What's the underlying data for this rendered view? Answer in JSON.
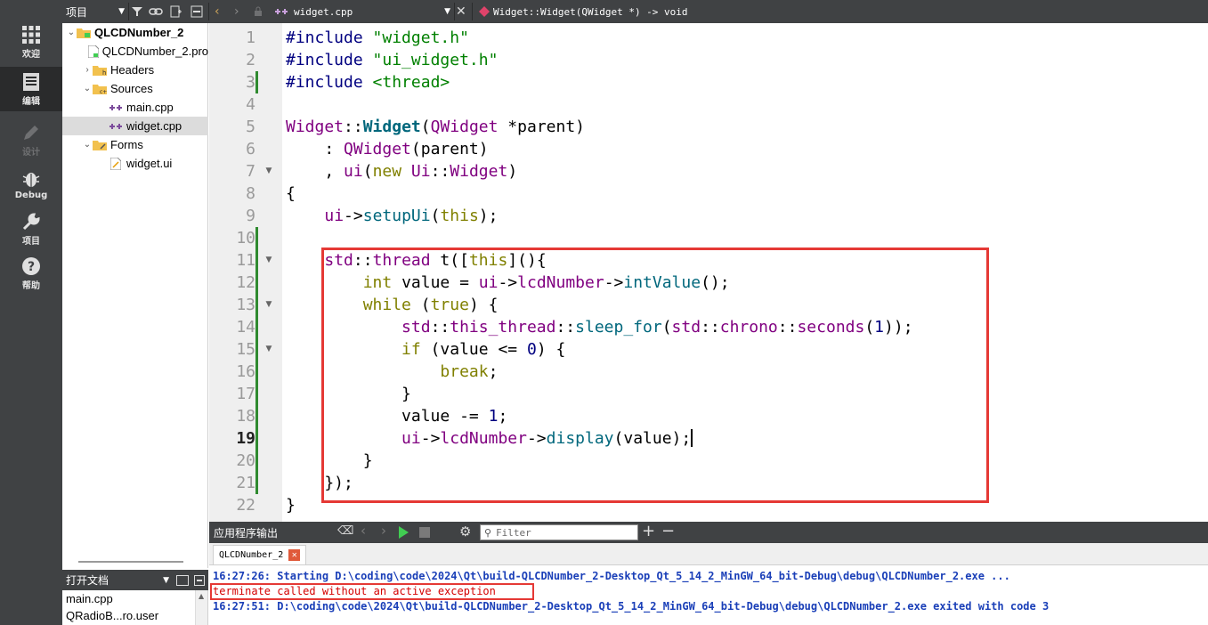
{
  "modes": [
    {
      "label": "欢迎",
      "icon": "grid-icon"
    },
    {
      "label": "编辑",
      "icon": "document-icon"
    },
    {
      "label": "设计",
      "icon": "pencil-icon"
    },
    {
      "label": "Debug",
      "icon": "bug-icon"
    },
    {
      "label": "项目",
      "icon": "wrench-icon"
    },
    {
      "label": "帮助",
      "icon": "help-icon"
    }
  ],
  "toolbar": {
    "view_selector": "项目",
    "file_name": "widget.cpp",
    "symbol": "Widget::Widget(QWidget *) -> void"
  },
  "project_tree": [
    {
      "label": "QLCDNumber_2",
      "indent": 0,
      "arrow": "down",
      "icon": "project-icon",
      "bold": true
    },
    {
      "label": "QLCDNumber_2.pro",
      "indent": 1,
      "arrow": "",
      "icon": "pro-file-icon"
    },
    {
      "label": "Headers",
      "indent": 1,
      "arrow": "right",
      "icon": "headers-folder-icon"
    },
    {
      "label": "Sources",
      "indent": 1,
      "arrow": "down",
      "icon": "sources-folder-icon"
    },
    {
      "label": "main.cpp",
      "indent": 2,
      "arrow": "",
      "icon": "cpp-file-icon"
    },
    {
      "label": "widget.cpp",
      "indent": 2,
      "arrow": "",
      "icon": "cpp-file-icon",
      "selected": true
    },
    {
      "label": "Forms",
      "indent": 1,
      "arrow": "down",
      "icon": "forms-folder-icon"
    },
    {
      "label": "widget.ui",
      "indent": 2,
      "arrow": "",
      "icon": "ui-file-icon"
    }
  ],
  "open_documents": {
    "title": "打开文档",
    "items": [
      "main.cpp",
      "QRadioB...ro.user"
    ]
  },
  "editor": {
    "current_line": 19,
    "lines": [
      {
        "n": "1",
        "tokens": [
          {
            "t": "#include ",
            "c": "pp"
          },
          {
            "t": "\"widget.h\"",
            "c": "st"
          }
        ]
      },
      {
        "n": "2",
        "tokens": [
          {
            "t": "#include ",
            "c": "pp"
          },
          {
            "t": "\"ui_widget.h\"",
            "c": "st"
          }
        ]
      },
      {
        "n": "3",
        "tokens": [
          {
            "t": "#include ",
            "c": "pp"
          },
          {
            "t": "<thread>",
            "c": "st"
          }
        ]
      },
      {
        "n": "4",
        "tokens": []
      },
      {
        "n": "5",
        "tokens": [
          {
            "t": "Widget",
            "c": "ty"
          },
          {
            "t": "::",
            "c": ""
          },
          {
            "t": "Widget",
            "c": "fnb"
          },
          {
            "t": "(",
            "c": ""
          },
          {
            "t": "QWidget",
            "c": "ty"
          },
          {
            "t": " *",
            "c": ""
          },
          {
            "t": "parent",
            "c": ""
          },
          {
            "t": ")",
            "c": ""
          }
        ]
      },
      {
        "n": "6",
        "tokens": [
          {
            "t": "    : ",
            "c": ""
          },
          {
            "t": "QWidget",
            "c": "ty"
          },
          {
            "t": "(",
            "c": ""
          },
          {
            "t": "parent",
            "c": ""
          },
          {
            "t": ")",
            "c": ""
          }
        ]
      },
      {
        "n": "7",
        "tokens": [
          {
            "t": "    , ",
            "c": ""
          },
          {
            "t": "ui",
            "c": "ty"
          },
          {
            "t": "(",
            "c": ""
          },
          {
            "t": "new",
            "c": "kw"
          },
          {
            "t": " ",
            "c": ""
          },
          {
            "t": "Ui",
            "c": "ty"
          },
          {
            "t": "::",
            "c": ""
          },
          {
            "t": "Widget",
            "c": "ty"
          },
          {
            "t": ")",
            "c": ""
          }
        ]
      },
      {
        "n": "8",
        "tokens": [
          {
            "t": "{",
            "c": ""
          }
        ]
      },
      {
        "n": "9",
        "tokens": [
          {
            "t": "    ",
            "c": ""
          },
          {
            "t": "ui",
            "c": "ty"
          },
          {
            "t": "->",
            "c": ""
          },
          {
            "t": "setupUi",
            "c": "fn"
          },
          {
            "t": "(",
            "c": ""
          },
          {
            "t": "this",
            "c": "kw"
          },
          {
            "t": ");",
            "c": ""
          }
        ]
      },
      {
        "n": "10",
        "tokens": []
      },
      {
        "n": "11",
        "tokens": [
          {
            "t": "    ",
            "c": ""
          },
          {
            "t": "std",
            "c": "ty"
          },
          {
            "t": "::",
            "c": ""
          },
          {
            "t": "thread",
            "c": "ty"
          },
          {
            "t": " t([",
            "c": ""
          },
          {
            "t": "this",
            "c": "kw"
          },
          {
            "t": "](){",
            "c": ""
          }
        ]
      },
      {
        "n": "12",
        "tokens": [
          {
            "t": "        ",
            "c": ""
          },
          {
            "t": "int",
            "c": "kw"
          },
          {
            "t": " ",
            "c": ""
          },
          {
            "t": "value",
            "c": ""
          },
          {
            "t": " = ",
            "c": ""
          },
          {
            "t": "ui",
            "c": "ty"
          },
          {
            "t": "->",
            "c": ""
          },
          {
            "t": "lcdNumber",
            "c": "ty"
          },
          {
            "t": "->",
            "c": ""
          },
          {
            "t": "intValue",
            "c": "fn"
          },
          {
            "t": "();",
            "c": ""
          }
        ]
      },
      {
        "n": "13",
        "tokens": [
          {
            "t": "        ",
            "c": ""
          },
          {
            "t": "while",
            "c": "kw"
          },
          {
            "t": " (",
            "c": ""
          },
          {
            "t": "true",
            "c": "kw"
          },
          {
            "t": ") {",
            "c": ""
          }
        ]
      },
      {
        "n": "14",
        "tokens": [
          {
            "t": "            ",
            "c": ""
          },
          {
            "t": "std",
            "c": "ty"
          },
          {
            "t": "::",
            "c": ""
          },
          {
            "t": "this_thread",
            "c": "ty"
          },
          {
            "t": "::",
            "c": ""
          },
          {
            "t": "sleep_for",
            "c": "fn"
          },
          {
            "t": "(",
            "c": ""
          },
          {
            "t": "std",
            "c": "ty"
          },
          {
            "t": "::",
            "c": ""
          },
          {
            "t": "chrono",
            "c": "ty"
          },
          {
            "t": "::",
            "c": ""
          },
          {
            "t": "seconds",
            "c": "ty"
          },
          {
            "t": "(",
            "c": ""
          },
          {
            "t": "1",
            "c": "nm"
          },
          {
            "t": "));",
            "c": ""
          }
        ]
      },
      {
        "n": "15",
        "tokens": [
          {
            "t": "            ",
            "c": ""
          },
          {
            "t": "if",
            "c": "kw"
          },
          {
            "t": " (",
            "c": ""
          },
          {
            "t": "value",
            "c": ""
          },
          {
            "t": " <= ",
            "c": ""
          },
          {
            "t": "0",
            "c": "nm"
          },
          {
            "t": ") {",
            "c": ""
          }
        ]
      },
      {
        "n": "16",
        "tokens": [
          {
            "t": "                ",
            "c": ""
          },
          {
            "t": "break",
            "c": "kw"
          },
          {
            "t": ";",
            "c": ""
          }
        ]
      },
      {
        "n": "17",
        "tokens": [
          {
            "t": "            }",
            "c": ""
          }
        ]
      },
      {
        "n": "18",
        "tokens": [
          {
            "t": "            ",
            "c": ""
          },
          {
            "t": "value",
            "c": ""
          },
          {
            "t": " -= ",
            "c": ""
          },
          {
            "t": "1",
            "c": "nm"
          },
          {
            "t": ";",
            "c": ""
          }
        ]
      },
      {
        "n": "19",
        "tokens": [
          {
            "t": "            ",
            "c": ""
          },
          {
            "t": "ui",
            "c": "ty"
          },
          {
            "t": "->",
            "c": ""
          },
          {
            "t": "lcdNumber",
            "c": "ty"
          },
          {
            "t": "->",
            "c": ""
          },
          {
            "t": "display",
            "c": "fn"
          },
          {
            "t": "(",
            "c": ""
          },
          {
            "t": "value",
            "c": ""
          },
          {
            "t": ");",
            "c": ""
          }
        ],
        "cursor": true
      },
      {
        "n": "20",
        "tokens": [
          {
            "t": "        }",
            "c": ""
          }
        ]
      },
      {
        "n": "21",
        "tokens": [
          {
            "t": "    });",
            "c": ""
          }
        ]
      },
      {
        "n": "22",
        "tokens": [
          {
            "t": "}",
            "c": ""
          }
        ]
      }
    ],
    "fold_markers": [
      "7",
      "11",
      "13",
      "15"
    ]
  },
  "output": {
    "title": "应用程序输出",
    "filter_placeholder": "Filter",
    "tab_label": "QLCDNumber_2",
    "lines": [
      {
        "text": "16:27:26: Starting D:\\coding\\code\\2024\\Qt\\build-QLCDNumber_2-Desktop_Qt_5_14_2_MinGW_64_bit-Debug\\debug\\QLCDNumber_2.exe ...",
        "style": "blue"
      },
      {
        "text": "terminate called without an active exception",
        "style": "red"
      },
      {
        "text": "16:27:51: D:\\coding\\code\\2024\\Qt\\build-QLCDNumber_2-Desktop_Qt_5_14_2_MinGW_64_bit-Debug\\debug\\QLCDNumber_2.exe exited with code 3",
        "style": "blue"
      }
    ]
  },
  "colors": {
    "highlight_box": "#e53935",
    "changed_line_marker": "#2f8a2f",
    "dark_panel": "#404244"
  }
}
